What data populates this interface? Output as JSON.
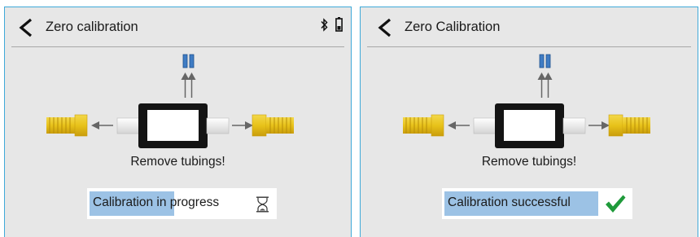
{
  "left_screen": {
    "title": "Zero calibration",
    "status_icons": [
      "bluetooth-icon",
      "battery-icon"
    ],
    "instruction": "Remove tubings!",
    "status_text": "Calibration in progress",
    "status_icon": "hourglass-icon",
    "progress_fraction": 0.46
  },
  "right_screen": {
    "title": "Zero Calibration",
    "instruction": "Remove tubings!",
    "status_text": "Calibration successful",
    "status_icon": "checkmark-icon"
  },
  "colors": {
    "frame_border": "#3fa9d9",
    "screen_background": "#e7e7e7",
    "progress_fill": "#9cc2e5",
    "success_check": "#1f9a3a",
    "tube_gold": "#e8c62a",
    "port_blue": "#3f7cc4"
  }
}
